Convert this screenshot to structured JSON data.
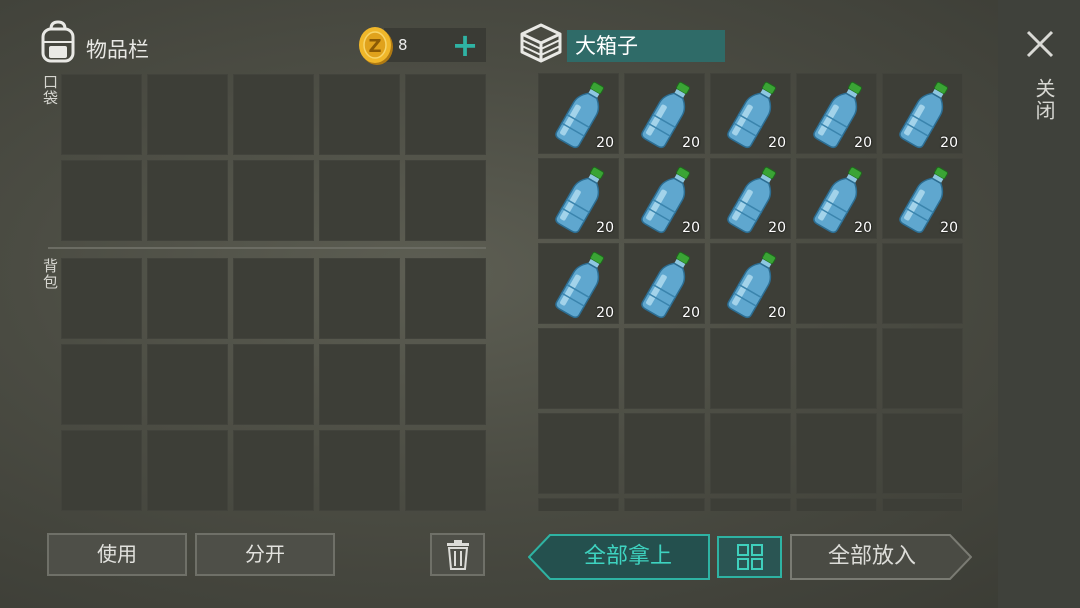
{
  "inventory": {
    "title": "物品栏",
    "pocket_label": "口袋",
    "backpack_label": "背包",
    "coin_count": "8"
  },
  "container": {
    "name": "大箱子"
  },
  "close_label": "关闭",
  "buttons": {
    "use": "使用",
    "split": "分开",
    "take_all": "全部拿上",
    "put_all": "全部放入"
  },
  "container_items": [
    {
      "item": "water-bottle",
      "count": "20"
    },
    {
      "item": "water-bottle",
      "count": "20"
    },
    {
      "item": "water-bottle",
      "count": "20"
    },
    {
      "item": "water-bottle",
      "count": "20"
    },
    {
      "item": "water-bottle",
      "count": "20"
    },
    {
      "item": "water-bottle",
      "count": "20"
    },
    {
      "item": "water-bottle",
      "count": "20"
    },
    {
      "item": "water-bottle",
      "count": "20"
    },
    {
      "item": "water-bottle",
      "count": "20"
    },
    {
      "item": "water-bottle",
      "count": "20"
    },
    {
      "item": "water-bottle",
      "count": "20"
    },
    {
      "item": "water-bottle",
      "count": "20"
    },
    {
      "item": "water-bottle",
      "count": "20"
    }
  ],
  "icons": {
    "inventory": "backpack-icon",
    "coin": "coin-icon",
    "add": "plus-icon",
    "container": "crate-icon",
    "close": "close-icon",
    "trash": "trash-icon",
    "sort": "sort-icon"
  },
  "colors": {
    "accent": "#2fb3a4",
    "box_name_bg": "#2f6b68"
  }
}
